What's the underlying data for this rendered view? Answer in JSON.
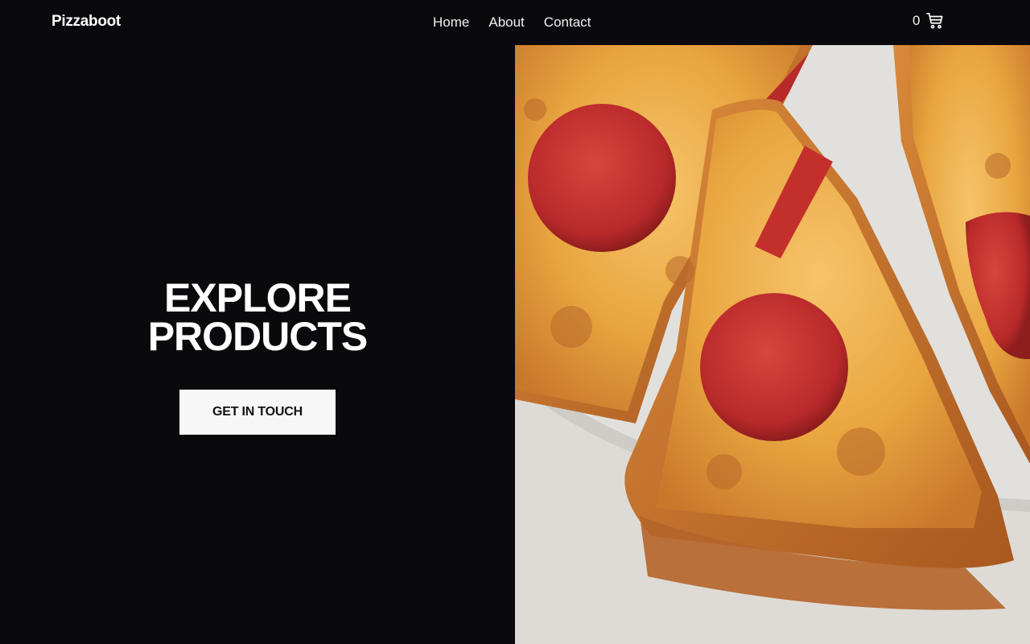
{
  "brand": {
    "name": "Pizzaboot"
  },
  "nav": {
    "items": [
      {
        "label": "Home"
      },
      {
        "label": "About"
      },
      {
        "label": "Contact"
      }
    ]
  },
  "cart": {
    "count": "0",
    "icon": "cart-icon"
  },
  "hero": {
    "title_line1": "EXPLORE",
    "title_line2": "PRODUCTS",
    "button_label": "GET IN TOUCH",
    "image": "pepperoni-pizza-slices-photo"
  },
  "colors": {
    "background": "#0a0a0c",
    "text": "#ffffff",
    "button_bg": "#f7f7f7",
    "button_text": "#111111"
  }
}
